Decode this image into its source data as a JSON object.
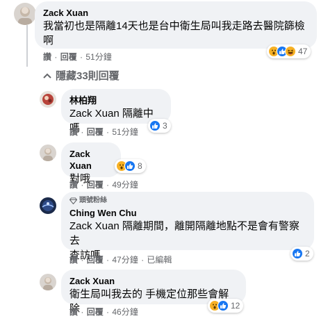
{
  "comment": {
    "author": "Zack Xuan",
    "text_line1": "我當初也是隔離14天也是台中衛生局叫我走路去醫院篩檢",
    "text_line2": "啊",
    "actions": {
      "like": "讚",
      "reply": "回覆",
      "time": "51分鐘"
    },
    "reactions": {
      "count": "47",
      "icons": [
        "wow-icon",
        "like-icon",
        "haha-icon"
      ]
    }
  },
  "hide_replies": {
    "label": "隱藏33則回覆"
  },
  "replies": [
    {
      "author": "林柏翔",
      "text_line1": "Zack Xuan 隔離中嗎",
      "text_line2": "",
      "actions": {
        "like": "讚",
        "reply": "回覆",
        "time": "51分鐘"
      },
      "reactions": {
        "count": "3",
        "icons": [
          "like-icon"
        ]
      }
    },
    {
      "author": "Zack Xuan",
      "text_line1": "對哦",
      "text_line2": "",
      "actions": {
        "like": "讚",
        "reply": "回覆",
        "time": "49分鐘"
      },
      "reactions": {
        "count": "8",
        "icons": [
          "wow-icon",
          "like-icon"
        ]
      }
    },
    {
      "badge": "頭號粉絲",
      "author": "Ching Wen Chu",
      "text_line1": "Zack Xuan 隔離期間，離開隔離地點不是會有警察去",
      "text_line2": "查訪嗎",
      "actions": {
        "like": "讚",
        "reply": "回覆",
        "time": "47分鐘",
        "edited": "已編輯"
      },
      "reactions": {
        "count": "2",
        "icons": [
          "like-icon"
        ]
      }
    },
    {
      "author": "Zack Xuan",
      "text_line1": "衛生局叫我去的 手機定位那些會解除",
      "text_line2": "",
      "actions": {
        "like": "讚",
        "reply": "回覆",
        "time": "46分鐘"
      },
      "reactions": {
        "count": "12",
        "icons": [
          "wow-icon",
          "like-icon"
        ]
      }
    }
  ],
  "colors": {
    "like": "#1877f2",
    "wow": "#f7b125",
    "bubble": "#f0f2f5",
    "meta": "#65676b"
  }
}
